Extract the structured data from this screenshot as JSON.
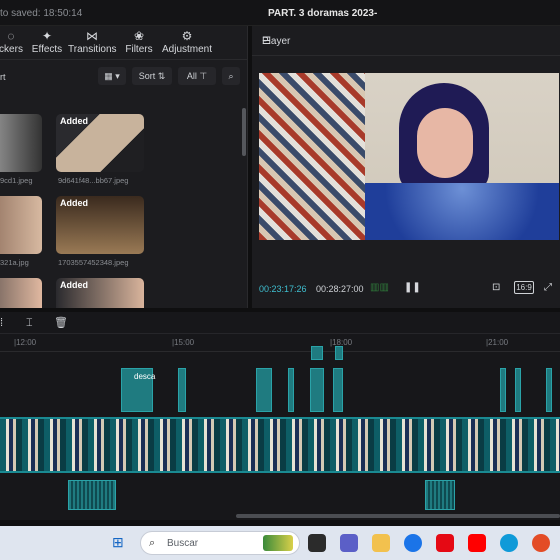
{
  "titlebar": {
    "autosave": "to saved: 18:50:14",
    "project": "PART. 3 doramas 2023-"
  },
  "left_tabs": [
    {
      "label": "ckers",
      "icon": "sticker-icon"
    },
    {
      "label": "Effects",
      "icon": "effects-icon"
    },
    {
      "label": "Transitions",
      "icon": "transitions-icon"
    },
    {
      "label": "Filters",
      "icon": "filters-icon"
    },
    {
      "label": "Adjustment",
      "icon": "adjustment-icon"
    }
  ],
  "media_toolbar": {
    "import_label": "rt",
    "sort_label": "Sort",
    "all_label": "All"
  },
  "media": [
    {
      "badge": "",
      "caption": "9cd1.jpeg"
    },
    {
      "badge": "Added",
      "caption": "9d641f48...bb67.jpeg"
    },
    {
      "badge": "",
      "caption": "321a.jpg"
    },
    {
      "badge": "Added",
      "caption": "1703557452348.jpeg"
    },
    {
      "badge": "",
      "caption": ""
    },
    {
      "badge": "Added",
      "caption": ""
    }
  ],
  "player": {
    "title": "Player",
    "current_time": "00:23:17:26",
    "total_time": "00:28:27:00",
    "ratio": "16:9"
  },
  "timeline": {
    "ticks": [
      "|12:00",
      "|15:00",
      "|18:00",
      "|21:00"
    ],
    "clip_label": "desca"
  },
  "taskbar": {
    "search_placeholder": "Buscar"
  }
}
